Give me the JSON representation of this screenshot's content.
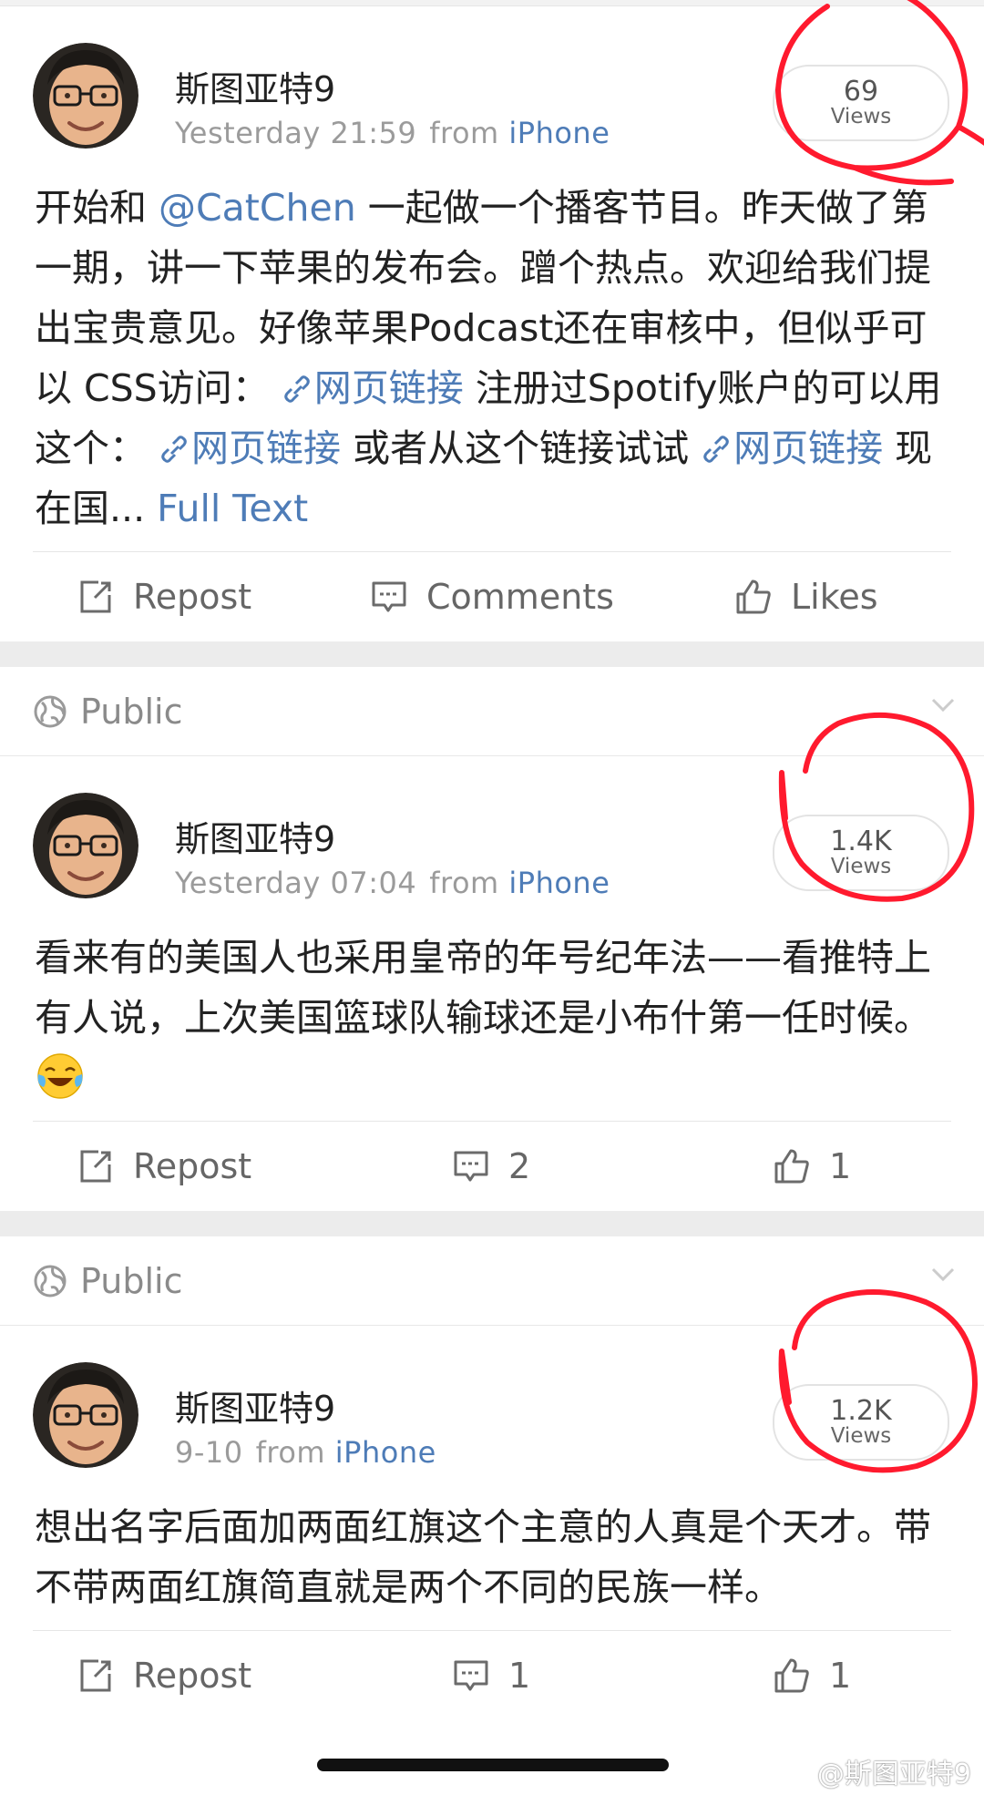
{
  "posts": [
    {
      "visibility": "",
      "author": "斯图亚特9",
      "time": "Yesterday 21:59",
      "from_label": "from",
      "source": "iPhone",
      "views_count": "69",
      "views_label": "Views",
      "body": {
        "t1": "开始和 ",
        "mention": "@CatChen",
        "t2": " 一起做一个播客节目。昨天做了第一期，讲一下苹果的发布会。蹭个热点。欢迎给我们提出宝贵意见。好像苹果Podcast还在审核中，但似乎可以 CSS访问：",
        "link1": "网页链接",
        "t3": " 注册过Spotify账户的可以用这个：",
        "link2": "网页链接",
        "t4": " 或者从这个链接试试 ",
        "link3": "网页链接",
        "t5": " 现在国... ",
        "full_text": "Full Text"
      },
      "actions": {
        "repost": "Repost",
        "comments": "Comments",
        "likes": "Likes"
      }
    },
    {
      "visibility": "Public",
      "author": "斯图亚特9",
      "time": "Yesterday 07:04",
      "from_label": "from",
      "source": "iPhone",
      "views_count": "1.4K",
      "views_label": "Views",
      "body": {
        "text": "看来有的美国人也采用皇帝的年号纪年法——看推特上有人说，上次美国篮球队输球还是小布什第一任时候。"
      },
      "actions": {
        "repost": "Repost",
        "comments": "2",
        "likes": "1"
      }
    },
    {
      "visibility": "Public",
      "author": "斯图亚特9",
      "time": "9-10",
      "from_label": "from",
      "source": "iPhone",
      "views_count": "1.2K",
      "views_label": "Views",
      "body": {
        "text": "想出名字后面加两面红旗这个主意的人真是个天才。带不带两面红旗简直就是两个不同的民族一样。"
      },
      "actions": {
        "repost": "Repost",
        "comments": "1",
        "likes": "1"
      }
    }
  ],
  "watermark": "@斯图亚特9",
  "colors": {
    "link": "#4e7cb7",
    "annotation_red": "#ff1a2e",
    "muted": "#9b9b9b"
  },
  "icons": [
    "globe-icon",
    "chevron-down-icon",
    "repost-icon",
    "comment-icon",
    "like-icon",
    "link-icon",
    "laughing-tears-emoji",
    "weibo-logo-icon"
  ]
}
